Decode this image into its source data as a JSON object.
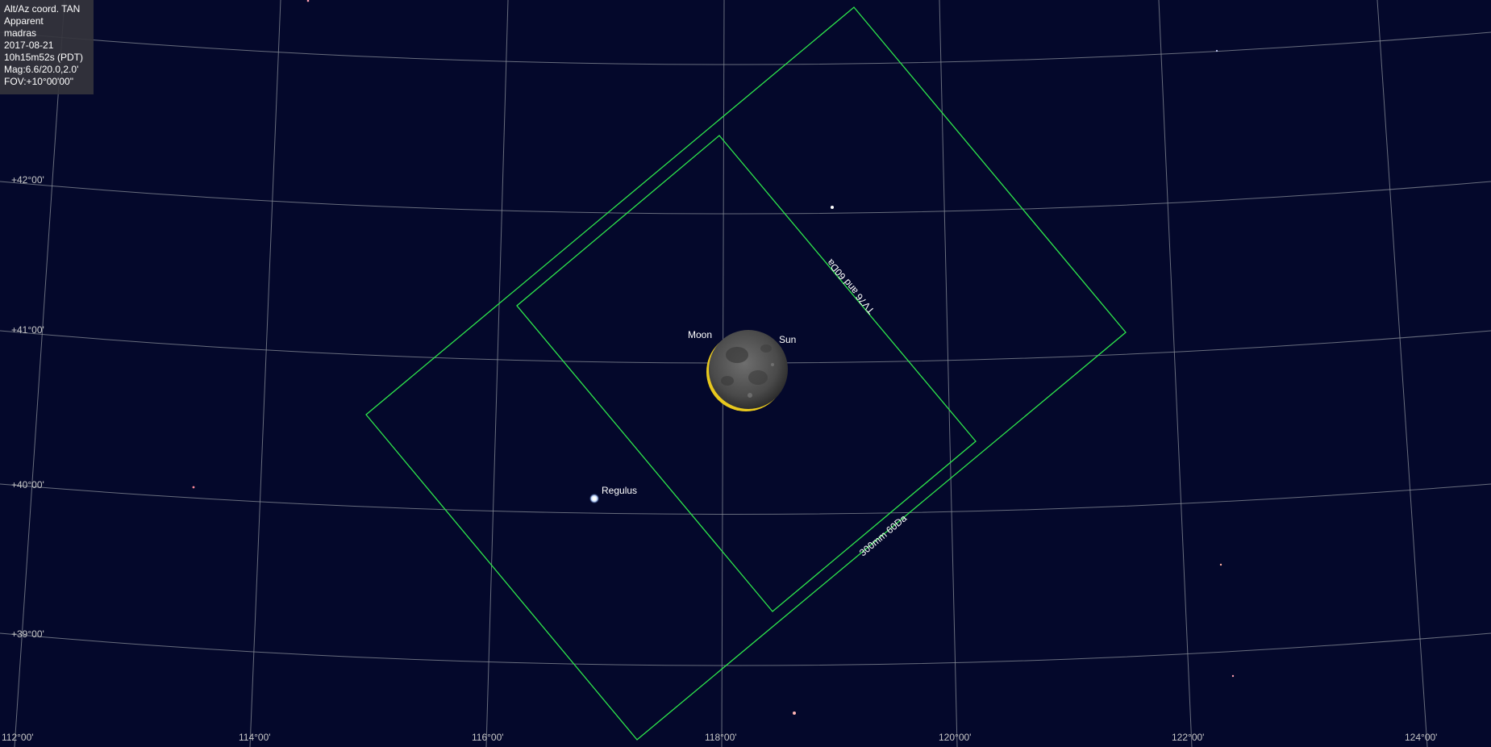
{
  "info_panel": {
    "lines": [
      "Alt/Az coord. TAN",
      "Apparent",
      "madras",
      "2017-08-21",
      "10h15m52s (PDT)",
      "Mag:6.6/20.0,2.0'",
      "FOV:+10°00'00\""
    ]
  },
  "grid": {
    "altitude_labels": [
      "+42°00'",
      "+41°00'",
      "+40°00'",
      "+39°00'"
    ],
    "azimuth_labels": [
      "112°00'",
      "114°00'",
      "116°00'",
      "118°00'",
      "120°00'",
      "122°00'",
      "124°00'"
    ]
  },
  "objects": {
    "moon_label": "Moon",
    "sun_label": "Sun",
    "regulus_label": "Regulus"
  },
  "fov_frames": {
    "outer_label": "300mm 60Da",
    "inner_label": "TV76 and 60Da"
  },
  "colors": {
    "sky": "#04082b",
    "fov": "#2ee84c",
    "grid": "#8a8f9a",
    "eclipse_rim": "#e8c81e"
  }
}
